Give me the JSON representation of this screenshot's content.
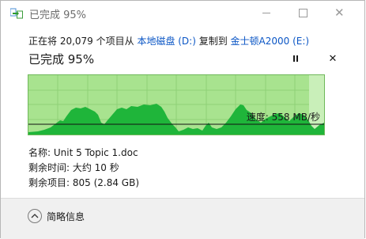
{
  "window": {
    "title": "已完成 95%",
    "icon": "copy-files-icon"
  },
  "copy_line": {
    "prefix": "正在将 20,079 个项目从 ",
    "source": "本地磁盘 (D:)",
    "middle": " 复制到 ",
    "destination": "金士顿A2000 (E:)"
  },
  "progress": {
    "title": "已完成 95%",
    "percent": 95,
    "speed_label": "速度: 558 MB/秒"
  },
  "details": {
    "name": "名称: Unit 5 Topic 1.doc",
    "time_remaining": "剩余时间: 大约 10 秒",
    "items_remaining": "剩余项目: 805 (2.84 GB)"
  },
  "footer": {
    "collapse_label": "简略信息"
  },
  "colors": {
    "graph_bg": "#a8e38f",
    "graph_fill": "#1fb53a",
    "link": "#0b56c5"
  }
}
